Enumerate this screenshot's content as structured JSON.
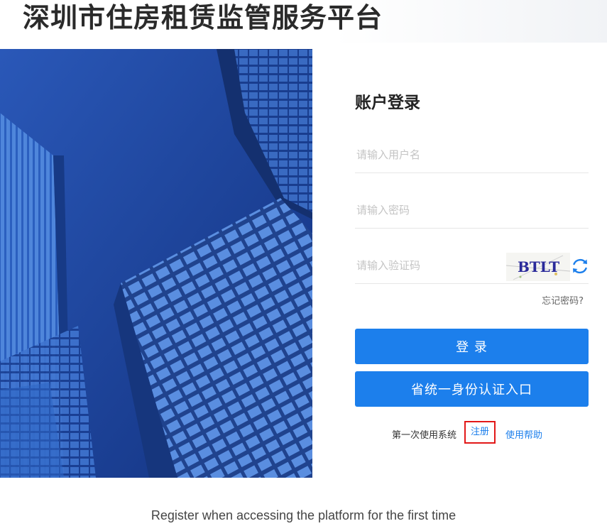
{
  "header": {
    "title": "深圳市住房租赁监管服务平台"
  },
  "login": {
    "heading": "账户登录",
    "username_placeholder": "请输入用户名",
    "password_placeholder": "请输入密码",
    "captcha_placeholder": "请输入验证码",
    "captcha_text": "BTLT",
    "forgot_password": "忘记密码?",
    "login_button": "登 录",
    "unified_identity_button": "省统一身份认证入口",
    "first_time_text": "第一次使用系统",
    "register_link": "注册",
    "help_link": "使用帮助"
  },
  "caption": {
    "text": "Register when accessing the platform for the first time"
  },
  "colors": {
    "primary": "#1c7fec",
    "highlight": "#e21818",
    "hero_blue": "#1e49a6"
  },
  "icons": {
    "refresh": "refresh-icon"
  }
}
